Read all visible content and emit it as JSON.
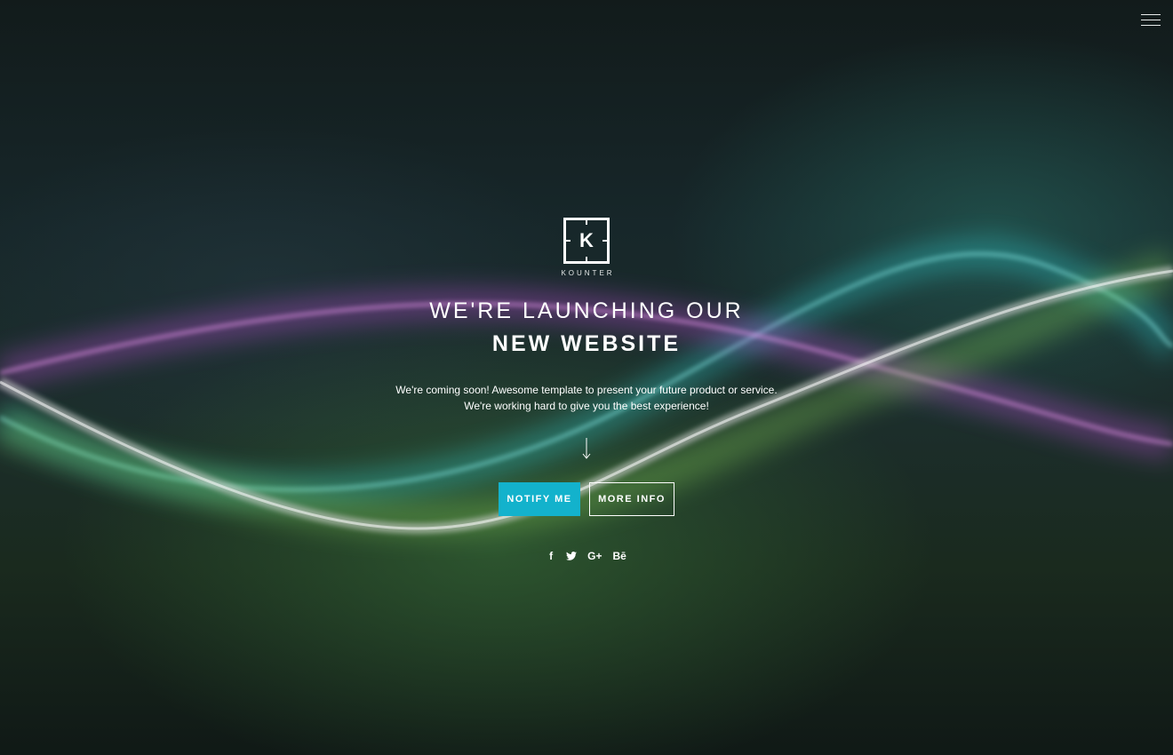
{
  "logo": {
    "letter": "K",
    "name": "KOUNTER"
  },
  "hero": {
    "title_light": "WE'RE LAUNCHING OUR",
    "title_bold": "NEW WEBSITE",
    "description_line1": "We're coming soon! Awesome template to present your future product or service.",
    "description_line2": "We're working hard to give you the best experience!"
  },
  "buttons": {
    "notify_label": "NOTIFY ME",
    "more_info_label": "MORE INFO"
  },
  "social": {
    "facebook": "f",
    "twitter": "🐦",
    "google_plus": "G+",
    "behance": "Bē"
  },
  "icons": {
    "menu": "hamburger-menu-icon",
    "scroll": "arrow-down-icon"
  },
  "colors": {
    "accent": "#13b2cc",
    "text": "#ffffff",
    "background": "#121b1b"
  }
}
